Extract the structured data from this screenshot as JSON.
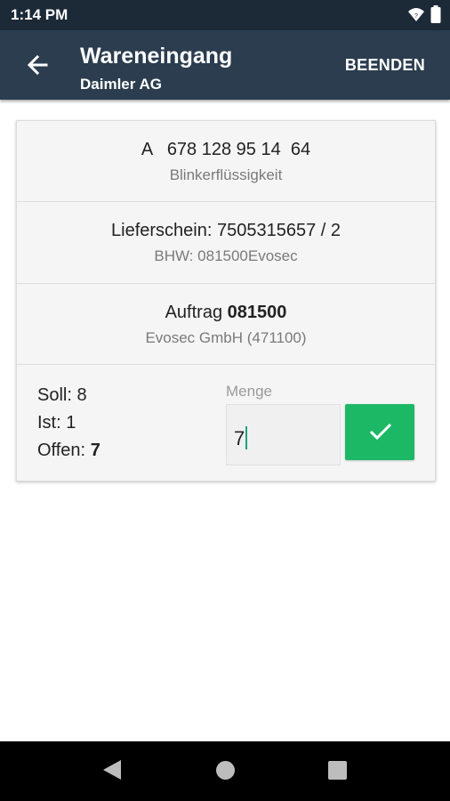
{
  "status_bar": {
    "time": "1:14 PM"
  },
  "app_bar": {
    "title": "Wareneingang",
    "subtitle": "Daimler AG",
    "finish_label": "BEENDEN"
  },
  "article": {
    "number": "A   678 128 95 14  64",
    "description": "Blinkerflüssigkeit"
  },
  "delivery": {
    "note": "Lieferschein: 7505315657 / 2",
    "bhw": "BHW: 081500Evosec"
  },
  "order": {
    "label": "Auftrag",
    "number": "081500",
    "customer": "Evosec GmbH (471100)"
  },
  "quantities": {
    "soll_label": "Soll:",
    "soll_value": "8",
    "ist_label": "Ist:",
    "ist_value": "1",
    "offen_label": "Offen:",
    "offen_value": "7"
  },
  "menge": {
    "label": "Menge",
    "value": "7"
  },
  "colors": {
    "status_bar": "#1c2a38",
    "app_bar": "#2b3d4f",
    "confirm": "#1db866"
  },
  "icons": {
    "back": "arrow-left-icon",
    "confirm": "checkmark-icon",
    "nav_back": "triangle-back-icon",
    "nav_home": "circle-home-icon",
    "nav_recents": "square-recents-icon"
  }
}
